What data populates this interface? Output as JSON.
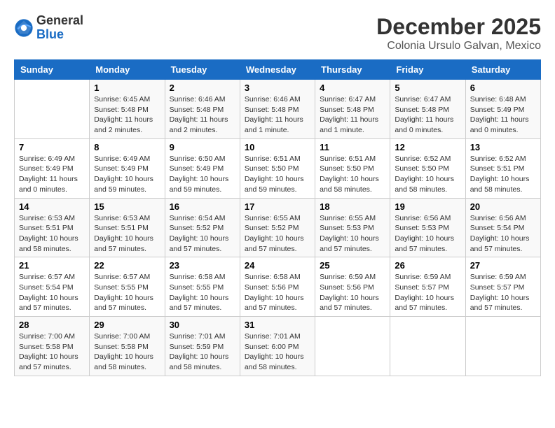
{
  "header": {
    "logo_general": "General",
    "logo_blue": "Blue",
    "month_title": "December 2025",
    "location": "Colonia Ursulo Galvan, Mexico"
  },
  "weekdays": [
    "Sunday",
    "Monday",
    "Tuesday",
    "Wednesday",
    "Thursday",
    "Friday",
    "Saturday"
  ],
  "weeks": [
    [
      {
        "day": "",
        "info": ""
      },
      {
        "day": "1",
        "info": "Sunrise: 6:45 AM\nSunset: 5:48 PM\nDaylight: 11 hours\nand 2 minutes."
      },
      {
        "day": "2",
        "info": "Sunrise: 6:46 AM\nSunset: 5:48 PM\nDaylight: 11 hours\nand 2 minutes."
      },
      {
        "day": "3",
        "info": "Sunrise: 6:46 AM\nSunset: 5:48 PM\nDaylight: 11 hours\nand 1 minute."
      },
      {
        "day": "4",
        "info": "Sunrise: 6:47 AM\nSunset: 5:48 PM\nDaylight: 11 hours\nand 1 minute."
      },
      {
        "day": "5",
        "info": "Sunrise: 6:47 AM\nSunset: 5:48 PM\nDaylight: 11 hours\nand 0 minutes."
      },
      {
        "day": "6",
        "info": "Sunrise: 6:48 AM\nSunset: 5:49 PM\nDaylight: 11 hours\nand 0 minutes."
      }
    ],
    [
      {
        "day": "7",
        "info": "Sunrise: 6:49 AM\nSunset: 5:49 PM\nDaylight: 11 hours\nand 0 minutes."
      },
      {
        "day": "8",
        "info": "Sunrise: 6:49 AM\nSunset: 5:49 PM\nDaylight: 10 hours\nand 59 minutes."
      },
      {
        "day": "9",
        "info": "Sunrise: 6:50 AM\nSunset: 5:49 PM\nDaylight: 10 hours\nand 59 minutes."
      },
      {
        "day": "10",
        "info": "Sunrise: 6:51 AM\nSunset: 5:50 PM\nDaylight: 10 hours\nand 59 minutes."
      },
      {
        "day": "11",
        "info": "Sunrise: 6:51 AM\nSunset: 5:50 PM\nDaylight: 10 hours\nand 58 minutes."
      },
      {
        "day": "12",
        "info": "Sunrise: 6:52 AM\nSunset: 5:50 PM\nDaylight: 10 hours\nand 58 minutes."
      },
      {
        "day": "13",
        "info": "Sunrise: 6:52 AM\nSunset: 5:51 PM\nDaylight: 10 hours\nand 58 minutes."
      }
    ],
    [
      {
        "day": "14",
        "info": "Sunrise: 6:53 AM\nSunset: 5:51 PM\nDaylight: 10 hours\nand 58 minutes."
      },
      {
        "day": "15",
        "info": "Sunrise: 6:53 AM\nSunset: 5:51 PM\nDaylight: 10 hours\nand 57 minutes."
      },
      {
        "day": "16",
        "info": "Sunrise: 6:54 AM\nSunset: 5:52 PM\nDaylight: 10 hours\nand 57 minutes."
      },
      {
        "day": "17",
        "info": "Sunrise: 6:55 AM\nSunset: 5:52 PM\nDaylight: 10 hours\nand 57 minutes."
      },
      {
        "day": "18",
        "info": "Sunrise: 6:55 AM\nSunset: 5:53 PM\nDaylight: 10 hours\nand 57 minutes."
      },
      {
        "day": "19",
        "info": "Sunrise: 6:56 AM\nSunset: 5:53 PM\nDaylight: 10 hours\nand 57 minutes."
      },
      {
        "day": "20",
        "info": "Sunrise: 6:56 AM\nSunset: 5:54 PM\nDaylight: 10 hours\nand 57 minutes."
      }
    ],
    [
      {
        "day": "21",
        "info": "Sunrise: 6:57 AM\nSunset: 5:54 PM\nDaylight: 10 hours\nand 57 minutes."
      },
      {
        "day": "22",
        "info": "Sunrise: 6:57 AM\nSunset: 5:55 PM\nDaylight: 10 hours\nand 57 minutes."
      },
      {
        "day": "23",
        "info": "Sunrise: 6:58 AM\nSunset: 5:55 PM\nDaylight: 10 hours\nand 57 minutes."
      },
      {
        "day": "24",
        "info": "Sunrise: 6:58 AM\nSunset: 5:56 PM\nDaylight: 10 hours\nand 57 minutes."
      },
      {
        "day": "25",
        "info": "Sunrise: 6:59 AM\nSunset: 5:56 PM\nDaylight: 10 hours\nand 57 minutes."
      },
      {
        "day": "26",
        "info": "Sunrise: 6:59 AM\nSunset: 5:57 PM\nDaylight: 10 hours\nand 57 minutes."
      },
      {
        "day": "27",
        "info": "Sunrise: 6:59 AM\nSunset: 5:57 PM\nDaylight: 10 hours\nand 57 minutes."
      }
    ],
    [
      {
        "day": "28",
        "info": "Sunrise: 7:00 AM\nSunset: 5:58 PM\nDaylight: 10 hours\nand 57 minutes."
      },
      {
        "day": "29",
        "info": "Sunrise: 7:00 AM\nSunset: 5:58 PM\nDaylight: 10 hours\nand 58 minutes."
      },
      {
        "day": "30",
        "info": "Sunrise: 7:01 AM\nSunset: 5:59 PM\nDaylight: 10 hours\nand 58 minutes."
      },
      {
        "day": "31",
        "info": "Sunrise: 7:01 AM\nSunset: 6:00 PM\nDaylight: 10 hours\nand 58 minutes."
      },
      {
        "day": "",
        "info": ""
      },
      {
        "day": "",
        "info": ""
      },
      {
        "day": "",
        "info": ""
      }
    ]
  ]
}
